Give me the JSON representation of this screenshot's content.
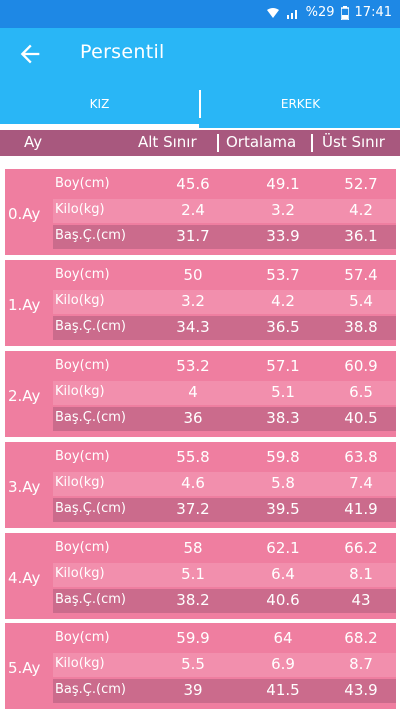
{
  "status_bar": {
    "battery": "%29",
    "time": "17:41"
  },
  "app_bar": {
    "title": "Persentil"
  },
  "tabs": [
    {
      "label": "KIZ"
    },
    {
      "label": "ERKEK"
    }
  ],
  "table_header": {
    "age": "Ay",
    "min": "Alt Sınır",
    "avg": "Ortalama",
    "max": "Üst Sınır"
  },
  "months": [
    {
      "age": "0.Ay",
      "rows": [
        {
          "label": "Boy(cm)",
          "min": "45.6",
          "avg": "49.1",
          "max": "52.7"
        },
        {
          "label": "Kilo(kg)",
          "min": "2.4",
          "avg": "3.2",
          "max": "4.2"
        },
        {
          "label": "Baş.Ç.(cm)",
          "min": "31.7",
          "avg": "33.9",
          "max": "36.1"
        }
      ]
    },
    {
      "age": "1.Ay",
      "rows": [
        {
          "label": "Boy(cm)",
          "min": "50",
          "avg": "53.7",
          "max": "57.4"
        },
        {
          "label": "Kilo(kg)",
          "min": "3.2",
          "avg": "4.2",
          "max": "5.4"
        },
        {
          "label": "Baş.Ç.(cm)",
          "min": "34.3",
          "avg": "36.5",
          "max": "38.8"
        }
      ]
    },
    {
      "age": "2.Ay",
      "rows": [
        {
          "label": "Boy(cm)",
          "min": "53.2",
          "avg": "57.1",
          "max": "60.9"
        },
        {
          "label": "Kilo(kg)",
          "min": "4",
          "avg": "5.1",
          "max": "6.5"
        },
        {
          "label": "Baş.Ç.(cm)",
          "min": "36",
          "avg": "38.3",
          "max": "40.5"
        }
      ]
    },
    {
      "age": "3.Ay",
      "rows": [
        {
          "label": "Boy(cm)",
          "min": "55.8",
          "avg": "59.8",
          "max": "63.8"
        },
        {
          "label": "Kilo(kg)",
          "min": "4.6",
          "avg": "5.8",
          "max": "7.4"
        },
        {
          "label": "Baş.Ç.(cm)",
          "min": "37.2",
          "avg": "39.5",
          "max": "41.9"
        }
      ]
    },
    {
      "age": "4.Ay",
      "rows": [
        {
          "label": "Boy(cm)",
          "min": "58",
          "avg": "62.1",
          "max": "66.2"
        },
        {
          "label": "Kilo(kg)",
          "min": "5.1",
          "avg": "6.4",
          "max": "8.1"
        },
        {
          "label": "Baş.Ç.(cm)",
          "min": "38.2",
          "avg": "40.6",
          "max": "43"
        }
      ]
    },
    {
      "age": "5.Ay",
      "rows": [
        {
          "label": "Boy(cm)",
          "min": "59.9",
          "avg": "64",
          "max": "68.2"
        },
        {
          "label": "Kilo(kg)",
          "min": "5.5",
          "avg": "6.9",
          "max": "8.7"
        },
        {
          "label": "Baş.Ç.(cm)",
          "min": "39",
          "avg": "41.5",
          "max": "43.9"
        }
      ]
    }
  ]
}
